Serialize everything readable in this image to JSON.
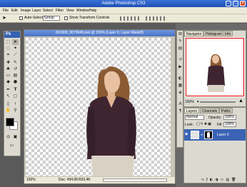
{
  "window": {
    "title": "Adobe Photoshop CS3"
  },
  "menu": [
    "File",
    "Edit",
    "Image",
    "Layer",
    "Select",
    "Filter",
    "View",
    "Window",
    "Help"
  ],
  "options": {
    "auto_select_label": "Auto-Select:",
    "auto_select_value": "Group",
    "transform_label": "Show Transform Controls"
  },
  "tools": {
    "logo": "Ps"
  },
  "document": {
    "title": "653368_3073648.psd @ 150% (Layer 0, Layer Mask/8)",
    "zoom": "150%",
    "doc_info": "Doc: 494.0K/933.4K"
  },
  "navigator": {
    "tabs": [
      "Navigator",
      "Histogram",
      "Info"
    ],
    "zoom": "150%"
  },
  "layers": {
    "tabs": [
      "Layers",
      "Channels",
      "Paths"
    ],
    "blend_mode": "Normal",
    "opacity_label": "Opacity:",
    "opacity_value": "100%",
    "lock_label": "Lock:",
    "fill_label": "Fill:",
    "fill_value": "100%",
    "layer_name": "Layer 0"
  }
}
